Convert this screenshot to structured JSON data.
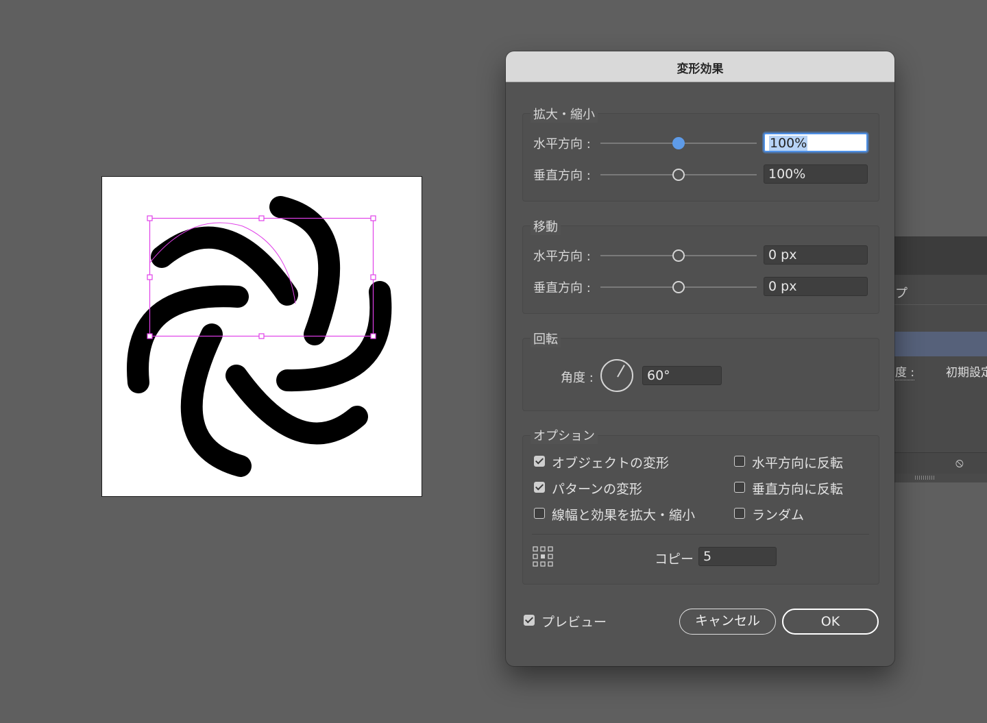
{
  "dialog": {
    "title": "変形効果",
    "scale": {
      "legend": "拡大・縮小",
      "horizontal_label": "水平方向 :",
      "horizontal_value": "100%",
      "vertical_label": "垂直方向 :",
      "vertical_value": "100%"
    },
    "move": {
      "legend": "移動",
      "horizontal_label": "水平方向 :",
      "horizontal_value": "0 px",
      "vertical_label": "垂直方向 :",
      "vertical_value": "0 px"
    },
    "rotate": {
      "legend": "回転",
      "angle_label": "角度 :",
      "angle_value": "60°"
    },
    "options": {
      "legend": "オプション",
      "transform_objects": {
        "label": "オブジェクトの変形",
        "checked": true
      },
      "transform_patterns": {
        "label": "パターンの変形",
        "checked": true
      },
      "scale_strokes": {
        "label": "線幅と効果を拡大・縮小",
        "checked": false
      },
      "reflect_x": {
        "label": "水平方向に反転",
        "checked": false
      },
      "reflect_y": {
        "label": "垂直方向に反転",
        "checked": false
      },
      "random": {
        "label": "ランダム",
        "checked": false
      },
      "copies_label": "コピー",
      "copies_value": "5"
    },
    "preview": {
      "label": "プレビュー",
      "checked": true
    },
    "cancel_label": "キャンセル",
    "ok_label": "OK"
  },
  "background_panel": {
    "tab_fragment": "プ",
    "opacity_label": "度 :",
    "opacity_value": "初期設定",
    "icon": "no-entry-icon"
  },
  "colors": {
    "canvas": "#5f5f5f",
    "dialog": "#535353",
    "titlebar": "#d9d9d9",
    "selection": "#e040e8",
    "slider_active": "#5e9be8"
  }
}
